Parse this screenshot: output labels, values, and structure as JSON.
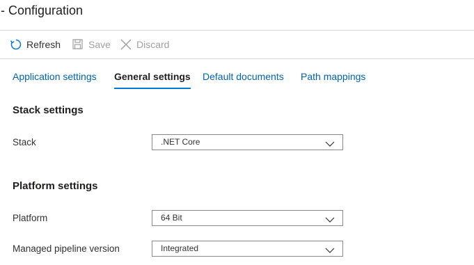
{
  "page": {
    "title": "- Configuration"
  },
  "toolbar": {
    "refresh": {
      "label": "Refresh",
      "icon": "refresh-icon"
    },
    "save": {
      "label": "Save",
      "icon": "save-icon",
      "disabled": true
    },
    "discard": {
      "label": "Discard",
      "icon": "close-icon",
      "disabled": true
    }
  },
  "tabs": [
    {
      "label": "Application settings",
      "active": false
    },
    {
      "label": "General settings",
      "active": true
    },
    {
      "label": "Default documents",
      "active": false
    },
    {
      "label": "Path mappings",
      "active": false
    }
  ],
  "stack_settings": {
    "heading": "Stack settings",
    "stack": {
      "label": "Stack",
      "value": ".NET Core"
    }
  },
  "platform_settings": {
    "heading": "Platform settings",
    "platform": {
      "label": "Platform",
      "value": "64 Bit"
    },
    "pipeline": {
      "label": "Managed pipeline version",
      "value": "Integrated"
    }
  },
  "colors": {
    "accent": "#0078d4",
    "link": "#0063b1",
    "disabled": "#a19f9d",
    "border": "#8a8886"
  }
}
